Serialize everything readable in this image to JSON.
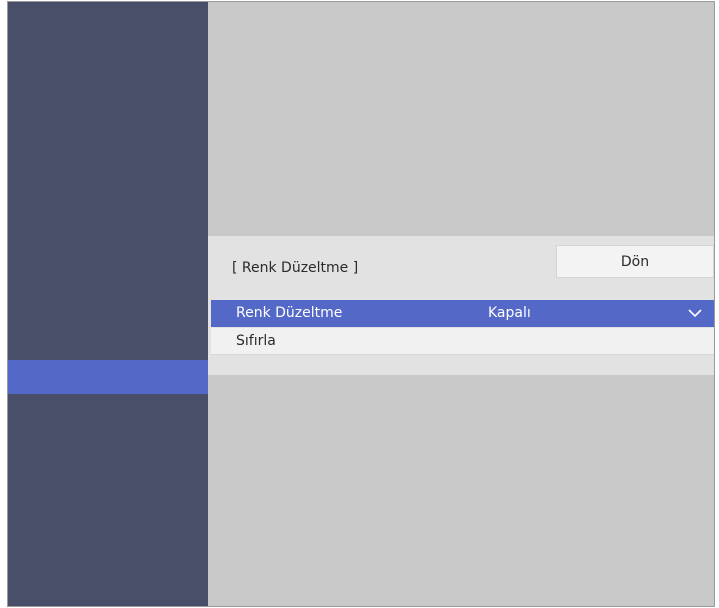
{
  "panel": {
    "title": "[ Renk Düzeltme ]",
    "back_label": "Dön"
  },
  "menu": {
    "items": [
      {
        "label": "Renk Düzeltme",
        "value": "Kapalı",
        "selected": true,
        "icon": "chevron-down-icon"
      },
      {
        "label": "Sıfırla",
        "value": "",
        "selected": false
      }
    ]
  },
  "colors": {
    "sidebar": "#494f69",
    "accent": "#5468c8",
    "background": "#c8c8c8",
    "panel": "#e2e2e2"
  }
}
